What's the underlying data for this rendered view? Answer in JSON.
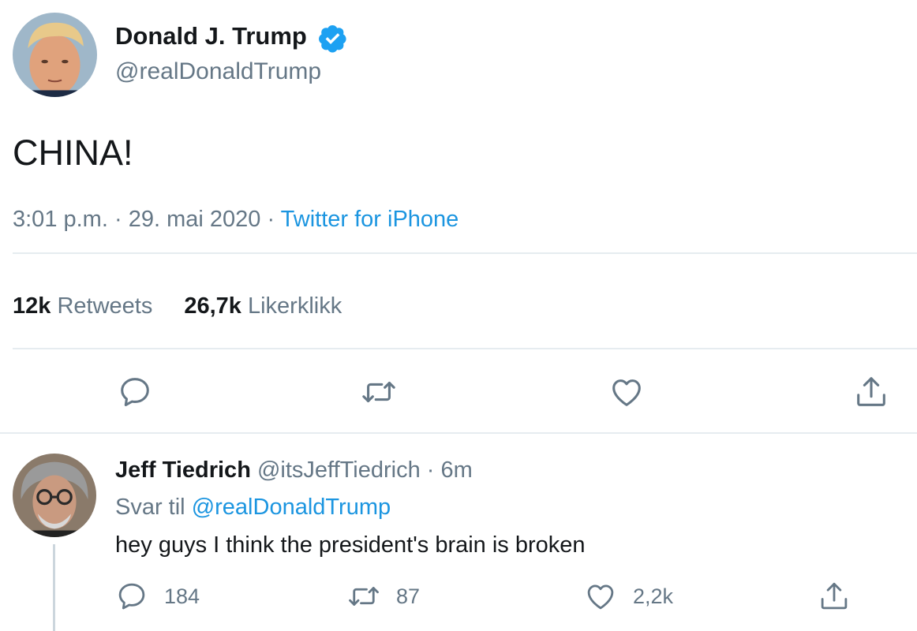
{
  "main_tweet": {
    "author_name": "Donald J. Trump",
    "author_handle": "@realDonaldTrump",
    "verified": true,
    "text": "CHINA!",
    "time": "3:01 p.m.",
    "date": "29. mai 2020",
    "separator": "·",
    "source": "Twitter for iPhone",
    "retweets_count": "12k",
    "retweets_label": "Retweets",
    "likes_count": "26,7k",
    "likes_label": "Likerklikk",
    "actions": [
      "reply-icon",
      "retweet-icon",
      "like-icon",
      "share-icon"
    ]
  },
  "reply_tweet": {
    "author_name": "Jeff Tiedrich",
    "author_handle": "@itsJeffTiedrich",
    "time_ago": "6m",
    "separator": "·",
    "reply_to_label": "Svar til",
    "reply_to_handle": "@realDonaldTrump",
    "text": "hey guys I think the president's brain is broken",
    "reply_count": "184",
    "retweet_count": "87",
    "like_count": "2,2k"
  },
  "colors": {
    "text_primary": "#14171a",
    "text_secondary": "#657786",
    "accent_blue": "#1b95e0",
    "divider": "#e6ecf0",
    "icon_gray": "#657786"
  }
}
